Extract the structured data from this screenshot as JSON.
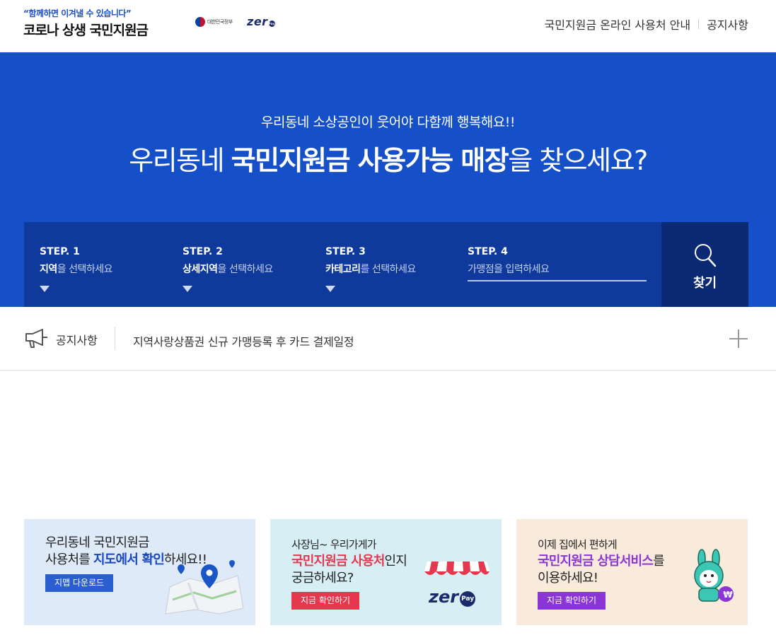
{
  "header": {
    "slogan": "“함께하면 이겨낼 수 있습니다”",
    "title": "코로나 상생 국민지원금",
    "gov_label": "대한민국정부",
    "zero_label": "zer",
    "zero_pay": "Pay",
    "nav": [
      "국민지원금 온라인 사용처 안내",
      "공지사항"
    ]
  },
  "hero": {
    "subtitle": "우리동네 소상공인이 웃어야 다함께 행복해요!!",
    "title_pre": "우리동네 ",
    "title_bold": "국민지원금 사용가능 매장",
    "title_post": "을 찾으세요?"
  },
  "steps": [
    {
      "label": "STEP. 1",
      "bold": "지역",
      "desc": "을 선택하세요"
    },
    {
      "label": "STEP. 2",
      "bold": "상세지역",
      "desc": "을 선택하세요"
    },
    {
      "label": "STEP. 3",
      "bold": "카테고리",
      "desc": "를 선택하세요"
    },
    {
      "label": "STEP. 4",
      "placeholder": "가맹점을 입력하세요"
    }
  ],
  "search_button": "찾기",
  "notice": {
    "label": "공지사항",
    "text": "지역사랑상품권 신규 가맹등록 후 카드 결제일정"
  },
  "banners": [
    {
      "line1": "우리동네 국민지원금",
      "line2_pre": "사용처를 ",
      "line2_bold": "지도에서 확인",
      "line2_post": "하세요!!",
      "button": "지맵 다운로드"
    },
    {
      "line1": "사장님~ 우리가게가",
      "line2_bold": "국민지원금 사용처",
      "line2_post": "인지",
      "line3": "궁금하세요?",
      "button": "지금 확인하기",
      "logo": "zer",
      "logo_pay": "Pay"
    },
    {
      "line1": "이제 집에서 편하게",
      "line2_bold": "국민지원금 상담서비스",
      "line2_post": "를",
      "line3": "이용하세요!",
      "button": "지금 확인하기",
      "coin": "₩"
    }
  ]
}
